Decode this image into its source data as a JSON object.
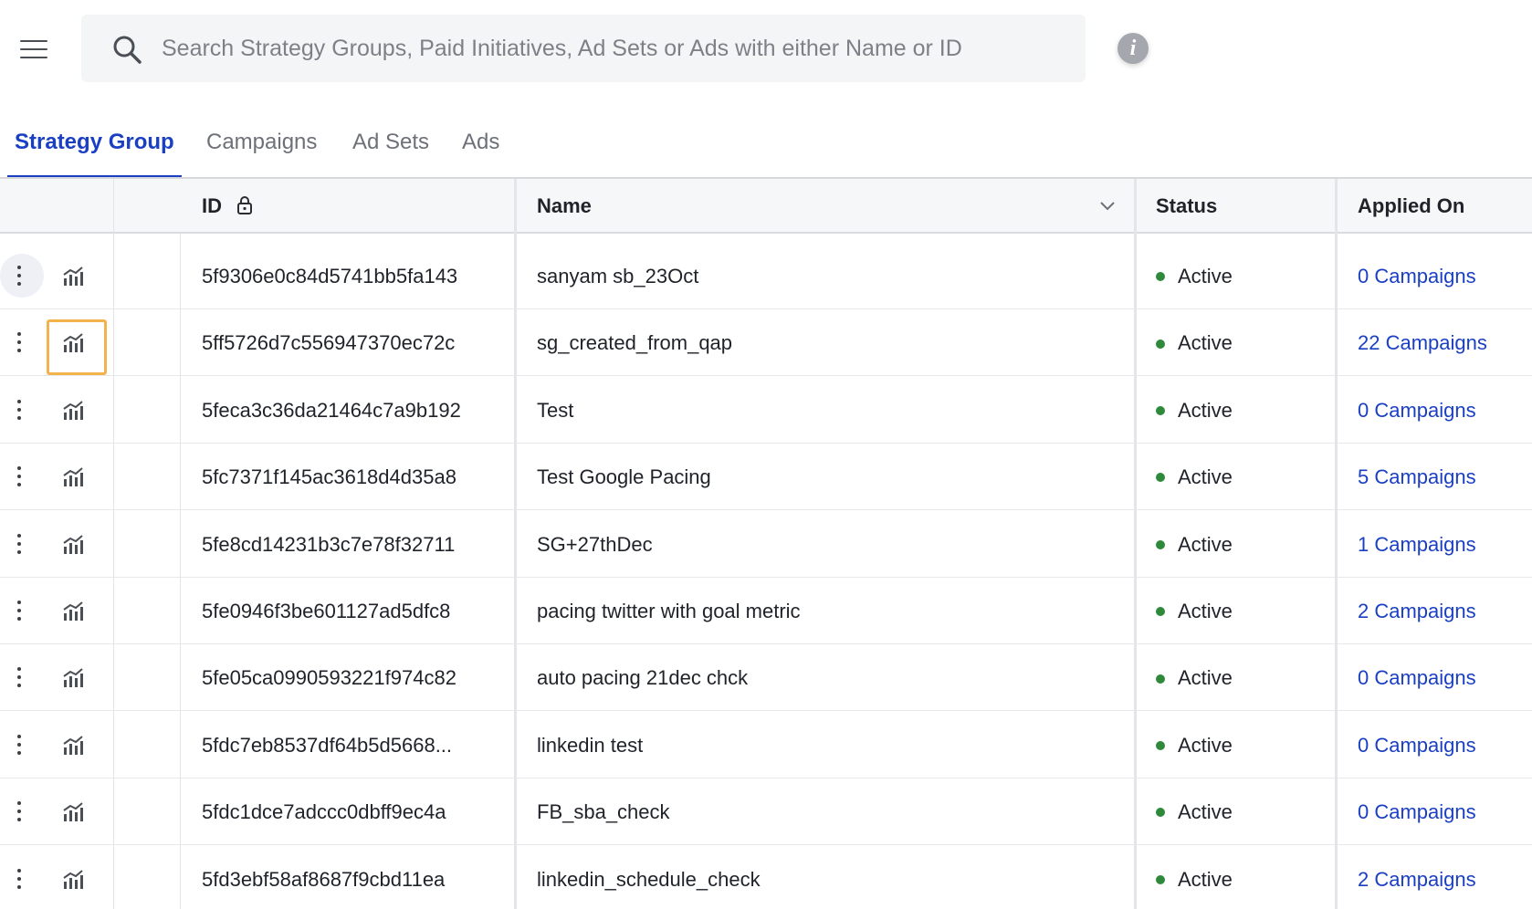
{
  "search": {
    "placeholder": "Search Strategy Groups, Paid Initiatives, Ad Sets or Ads with either Name or ID"
  },
  "info": {
    "glyph": "i"
  },
  "tabs": [
    {
      "label": "Strategy Group",
      "active": true
    },
    {
      "label": "Campaigns",
      "active": false
    },
    {
      "label": "Ad Sets",
      "active": false
    },
    {
      "label": "Ads",
      "active": false
    }
  ],
  "table": {
    "columns": {
      "id": "ID",
      "name": "Name",
      "status": "Status",
      "applied_on": "Applied On"
    },
    "rows": [
      {
        "id": "5f9306e0c84d5741bb5fa143",
        "name": "sanyam sb_23Oct",
        "status": "Active",
        "applied_on": "0 Campaigns"
      },
      {
        "id": "5ff5726d7c556947370ec72c",
        "name": "sg_created_from_qap",
        "status": "Active",
        "applied_on": "22 Campaigns"
      },
      {
        "id": "5feca3c36da21464c7a9b192",
        "name": "Test",
        "status": "Active",
        "applied_on": "0 Campaigns"
      },
      {
        "id": "5fc7371f145ac3618d4d35a8",
        "name": "Test Google Pacing",
        "status": "Active",
        "applied_on": "5 Campaigns"
      },
      {
        "id": "5fe8cd14231b3c7e78f32711",
        "name": "SG+27thDec",
        "status": "Active",
        "applied_on": "1 Campaigns"
      },
      {
        "id": "5fe0946f3be601127ad5dfc8",
        "name": "pacing twitter with goal metric",
        "status": "Active",
        "applied_on": "2 Campaigns"
      },
      {
        "id": "5fe05ca0990593221f974c82",
        "name": "auto pacing 21dec chck",
        "status": "Active",
        "applied_on": "0 Campaigns"
      },
      {
        "id": "5fdc7eb8537df64b5d5668...",
        "name": "linkedin test",
        "status": "Active",
        "applied_on": "0 Campaigns"
      },
      {
        "id": "5fdc1dce7adccc0dbff9ec4a",
        "name": "FB_sba_check",
        "status": "Active",
        "applied_on": "0 Campaigns"
      },
      {
        "id": "5fd3ebf58af8687f9cbd11ea",
        "name": "linkedin_schedule_check",
        "status": "Active",
        "applied_on": "2 Campaigns"
      }
    ]
  },
  "colors": {
    "accent": "#1a3fc2",
    "status_active": "#2e8a3a",
    "focus_outline": "#f2b44a"
  },
  "icons": {
    "menu": "hamburger-icon",
    "search": "search-icon",
    "info": "info-icon",
    "lock": "lock-icon",
    "sort": "chevron-down-icon",
    "row_actions": "kebab-menu-icon",
    "analytics": "chart-icon"
  }
}
